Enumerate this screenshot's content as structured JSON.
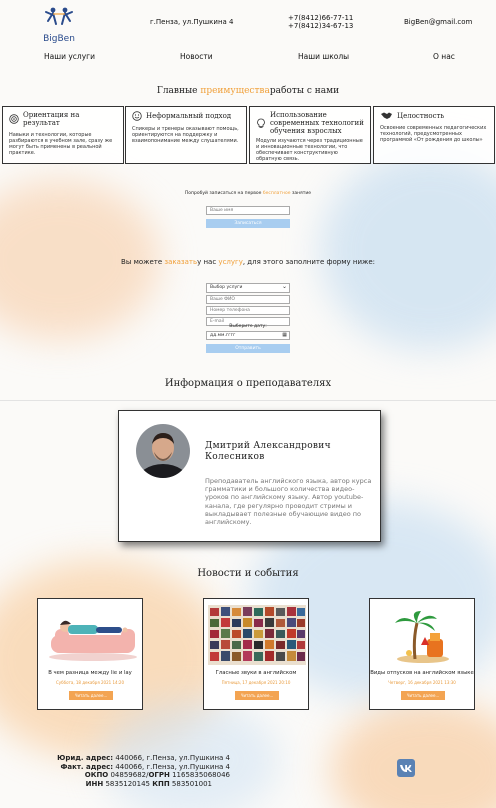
{
  "header": {
    "logo_text": "BigBen",
    "address": "г.Пенза, ул.Пушкина 4",
    "phone1": "+7(8412)66-77-11",
    "phone2": "+7(8412)34-67-13",
    "email": "BigBen@gmail.com"
  },
  "nav": [
    {
      "label": "Наши услуги"
    },
    {
      "label": "Новости"
    },
    {
      "label": "Наши школы"
    },
    {
      "label": "О нас"
    }
  ],
  "advantages": {
    "title_pre": "Главные ",
    "title_accent": "преимущества",
    "title_post": "работы с нами",
    "cards": [
      {
        "title": "Ориентация на результат",
        "icon": "target-icon",
        "text": "Навыки и технологии, которые разбираются в учебном зале, сразу же могут быть применены в реальной практике."
      },
      {
        "title": "Неформальный подход",
        "icon": "smile-icon",
        "text": "Спикеры и тренеры оказывают помощь, ориентируются на поддержку и взаимопонимание между слушателями."
      },
      {
        "title": "Использование современных технологий обучения взрослых",
        "icon": "lightbulb-icon",
        "text": "Модули изучаются через традиционные и инновационные технологии, что обеспечивает конструктивную обратную связь."
      },
      {
        "title": "Целостность",
        "icon": "handshake-icon",
        "text": "Освоение современных педагогических технологий, предусмотренных программой «От рождения до школы»"
      }
    ]
  },
  "trial": {
    "text_pre": "Попробуй записаться на первое ",
    "text_accent": "бесплатное",
    "text_post": " занятие",
    "name_placeholder": "Ваше имя",
    "button": "Записаться"
  },
  "order": {
    "text_pre": "Вы можете ",
    "text_accent1": "заказать",
    "text_mid": "у нас ",
    "text_accent2": "услугу",
    "text_post": ", для этого заполните форму ниже:",
    "select_value": "Выбор услуги",
    "fio_placeholder": "Ваше ФИО",
    "phone_placeholder": "Номер телефона",
    "email_placeholder": "E-mail",
    "date_label": "Выберите дату:",
    "date_placeholder": "дд.мм.гггг",
    "button": "Отправить"
  },
  "teachers": {
    "title": "Информация о преподавателях",
    "name": "Дмитрий Александрович Колесников",
    "bio": "Преподаватель английского языка, автор курса грамматики и большого количества видео-уроков по английскому языку. Автор youtube-канала, где регулярно проводит стримы и выкладывает полезные обучающие видео по английскому."
  },
  "news": {
    "title": "Новости и события",
    "items": [
      {
        "title": "В чем разница между lie и lay",
        "date": "Суббота, 18 декабря 2021 14:20",
        "button": "Читать далее..."
      },
      {
        "title": "Гласные звуки в английском",
        "date": "Пятница, 17 декабря 2021 20:10",
        "button": "Читать далее..."
      },
      {
        "title": "Виды отпусков на английском языке",
        "date": "Четверг, 16 декабря 2021 13:30",
        "button": "Читать далее..."
      }
    ]
  },
  "footer": {
    "legal_label": "Юрид. адрес:",
    "legal_value": " 440066, г.Пенза, ул.Пушкина 4",
    "fact_label": "Факт. адрес:",
    "fact_value": " 440066, г.Пенза, ул.Пушкина 4",
    "okpo_label": "ОКПО",
    "okpo_value": " 04859682/",
    "ogrn_label": "ОГРН",
    "ogrn_value": " 1165835068046",
    "inn_label": "ИНН",
    "inn_value": " 5835120145 ",
    "kpp_label": "КПП",
    "kpp_value": " 583501001",
    "social_icon": "vk-icon"
  },
  "colors": {
    "accent": "#f0a03a",
    "brand": "#2a4b8c",
    "button_blue": "#a8cdf0",
    "button_orange": "#f3a452"
  }
}
